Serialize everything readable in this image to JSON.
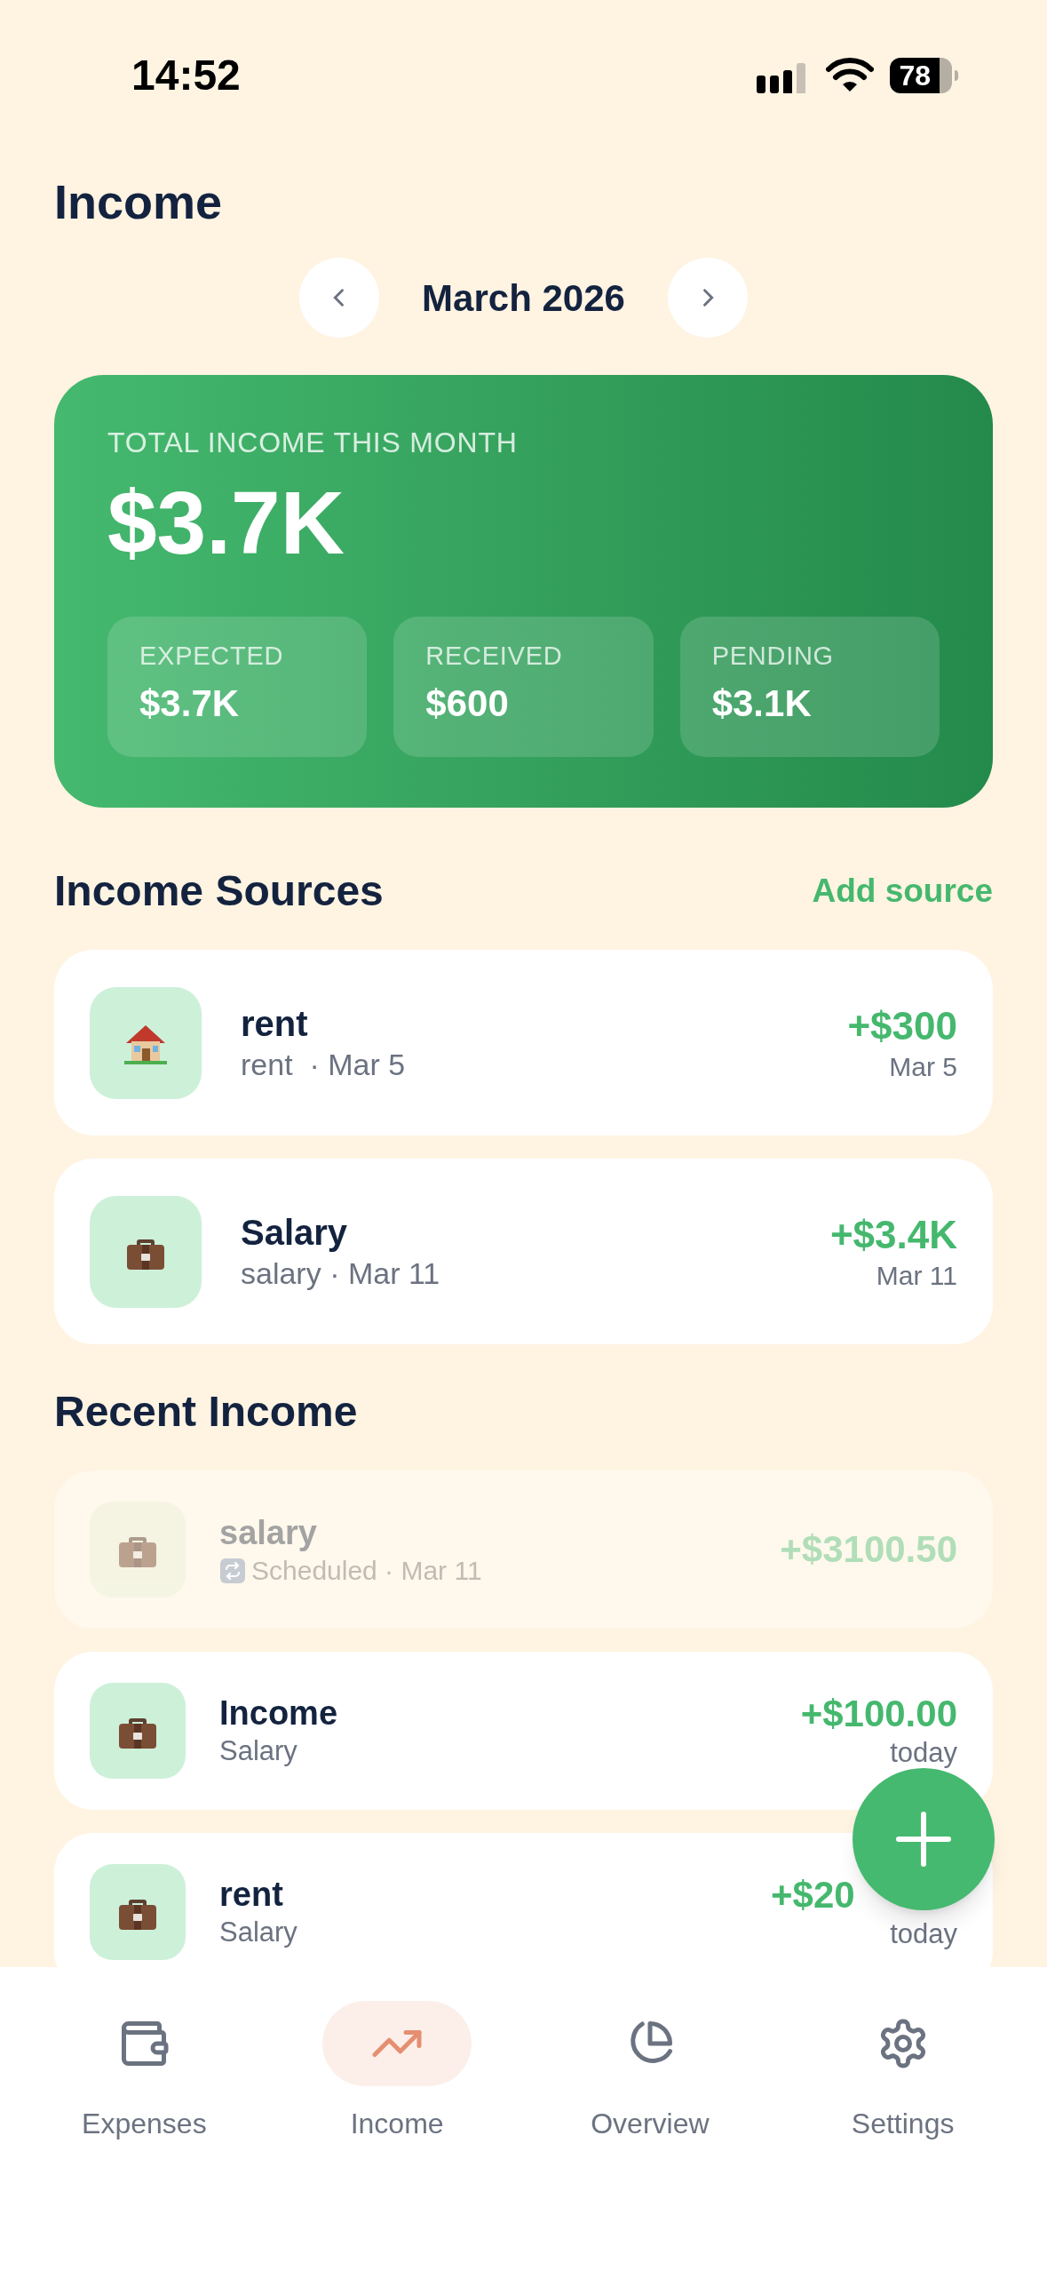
{
  "status_bar": {
    "time": "14:52",
    "battery": "78"
  },
  "title": "Income",
  "month_nav": {
    "label": "March 2026"
  },
  "summary": {
    "label": "TOTAL INCOME THIS MONTH",
    "total": "$3.7K",
    "stats": [
      {
        "label": "EXPECTED",
        "value": "$3.7K"
      },
      {
        "label": "RECEIVED",
        "value": "$600"
      },
      {
        "label": "PENDING",
        "value": "$3.1K"
      }
    ]
  },
  "sources": {
    "heading": "Income Sources",
    "action": "Add source",
    "items": [
      {
        "kind": "house",
        "name": "rent",
        "details": "rent  · Mar 5",
        "amount": "+$300",
        "due": "Mar 5"
      },
      {
        "kind": "briefcase",
        "name": "Salary",
        "details": "salary · Mar 11",
        "amount": "+$3.4K",
        "due": "Mar 11"
      }
    ]
  },
  "recent": {
    "heading": "Recent Income",
    "items": [
      {
        "kind": "briefcase",
        "name": "salary",
        "scheduled": true,
        "details": "Scheduled · Mar 11",
        "amount": "+$3100.50",
        "clipped": false
      },
      {
        "kind": "briefcase",
        "name": "Income",
        "scheduled": false,
        "details": "Salary",
        "amount": "+$100.00",
        "when": "today",
        "clipped": false
      },
      {
        "kind": "briefcase",
        "name": "rent",
        "scheduled": false,
        "details": "Salary",
        "amount": "+$20",
        "when": "today",
        "clipped": true
      }
    ]
  },
  "tabs": [
    {
      "kind": "wallet",
      "label": "Expenses",
      "selected": false
    },
    {
      "kind": "trend",
      "label": "Income",
      "selected": true
    },
    {
      "kind": "pie",
      "label": "Overview",
      "selected": false
    },
    {
      "kind": "gear",
      "label": "Settings",
      "selected": false
    }
  ]
}
